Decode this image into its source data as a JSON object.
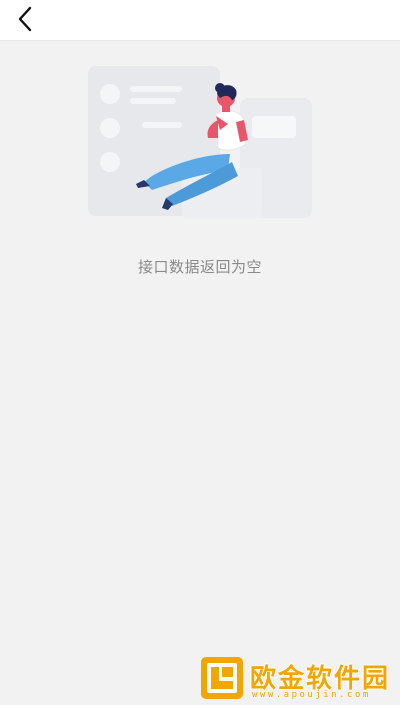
{
  "header": {
    "back_icon": "chevron-left-icon"
  },
  "empty_state": {
    "illustration_icon": "person-sitting-on-cards-illustration",
    "message": "接口数据返回为空"
  },
  "watermark": {
    "logo_icon": "apoujin-logo-icon",
    "brand_text": "欧金软件园",
    "url": "www.apoujin.com"
  },
  "colors": {
    "background": "#f2f2f3",
    "header_bg": "#ffffff",
    "message_text": "#8a8a8a",
    "accent_pink": "#e8566c",
    "accent_blue": "#5aa9e6",
    "watermark_gold": "#f2a600"
  }
}
